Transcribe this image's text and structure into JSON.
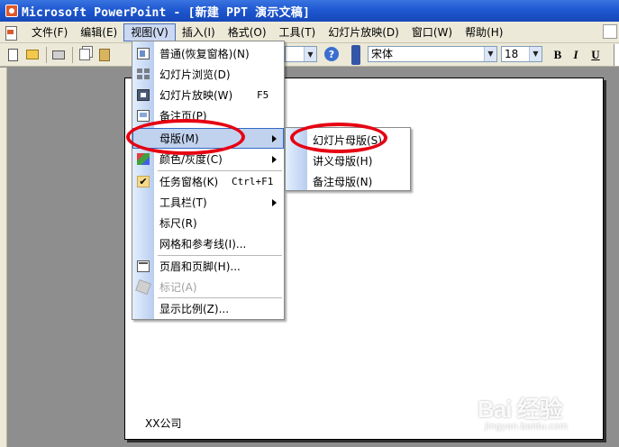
{
  "window": {
    "title": "Microsoft PowerPoint - [新建 PPT 演示文稿]"
  },
  "menubar": {
    "items": [
      {
        "label": "文件(F)"
      },
      {
        "label": "编辑(E)"
      },
      {
        "label": "视图(V)"
      },
      {
        "label": "插入(I)"
      },
      {
        "label": "格式(O)"
      },
      {
        "label": "工具(T)"
      },
      {
        "label": "幻灯片放映(D)"
      },
      {
        "label": "窗口(W)"
      },
      {
        "label": "帮助(H)"
      }
    ],
    "active_index": 2
  },
  "toolbar": {
    "font_name": "宋体",
    "font_size": "18",
    "bold_label": "B",
    "italic_label": "I",
    "underline_label": "U",
    "help_label": "?"
  },
  "view_menu": {
    "items": [
      {
        "label": "普通(恢复窗格)(N)",
        "icon": "normal-view-icon"
      },
      {
        "label": "幻灯片浏览(D)",
        "icon": "slide-sorter-icon"
      },
      {
        "label": "幻灯片放映(W)",
        "shortcut": "F5",
        "icon": "slide-show-icon"
      },
      {
        "label": "备注页(P)",
        "icon": "notes-page-icon"
      },
      {
        "label": "母版(M)",
        "has_submenu": true,
        "highlighted": true
      },
      {
        "label": "颜色/灰度(C)",
        "has_submenu": true,
        "icon": "color-grayscale-icon"
      },
      {
        "label": "任务窗格(K)",
        "shortcut": "Ctrl+F1",
        "checked": true
      },
      {
        "label": "工具栏(T)",
        "has_submenu": true
      },
      {
        "label": "标尺(R)"
      },
      {
        "label": "网格和参考线(I)..."
      },
      {
        "label": "页眉和页脚(H)...",
        "icon": "header-footer-icon"
      },
      {
        "label": "标记(A)",
        "disabled": true,
        "icon": "markup-icon"
      },
      {
        "label": "显示比例(Z)..."
      }
    ]
  },
  "master_submenu": {
    "items": [
      {
        "label": "幻灯片母版(S)"
      },
      {
        "label": "讲义母版(H)"
      },
      {
        "label": "备注母版(N)"
      }
    ]
  },
  "slide": {
    "footer_text": "XX公司"
  },
  "watermark": {
    "main": "Bai 经验",
    "sub": "jingyan.baidu.com"
  },
  "annotation": {
    "color": "#e60012"
  }
}
